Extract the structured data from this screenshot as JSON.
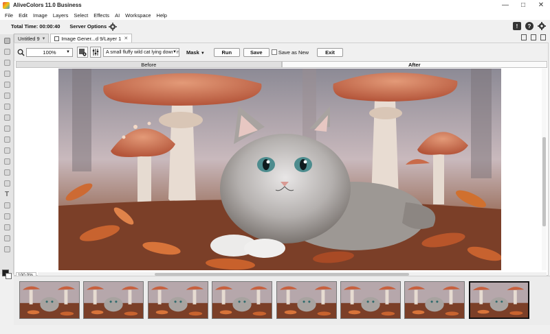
{
  "app": {
    "title": "AliveColors 11.0 Business",
    "window_controls": [
      "minimize",
      "maximize",
      "close"
    ]
  },
  "menu": [
    "File",
    "Edit",
    "Image",
    "Layers",
    "Select",
    "Effects",
    "AI",
    "Workspace",
    "Help"
  ],
  "options_bar": {
    "total_time_label": "Total Time: 00:00:40",
    "server_options_label": "Server Options",
    "right_icons": [
      "notification-icon",
      "help-icon",
      "settings-icon"
    ]
  },
  "tabs": [
    {
      "label": "Untitled 9",
      "active": false
    },
    {
      "label": "Image Gener...d 9/Layer 1",
      "active": true
    }
  ],
  "plugin": {
    "zoom": "100%",
    "prompt": "A small fluffy wild cat lying down in",
    "mask_label": "Mask",
    "run_label": "Run",
    "save_label": "Save",
    "save_as_new_label": "Save as New",
    "save_as_new_checked": false,
    "exit_label": "Exit",
    "before_label": "Before",
    "after_label": "After",
    "zoom_readout": "100.0%",
    "active_view": "After"
  },
  "filmstrip": {
    "count": 8,
    "selected_index": 7
  },
  "colors": {
    "foreground": "#1f1f1f",
    "background": "#ffffff",
    "accent": "#3a3a3a"
  }
}
